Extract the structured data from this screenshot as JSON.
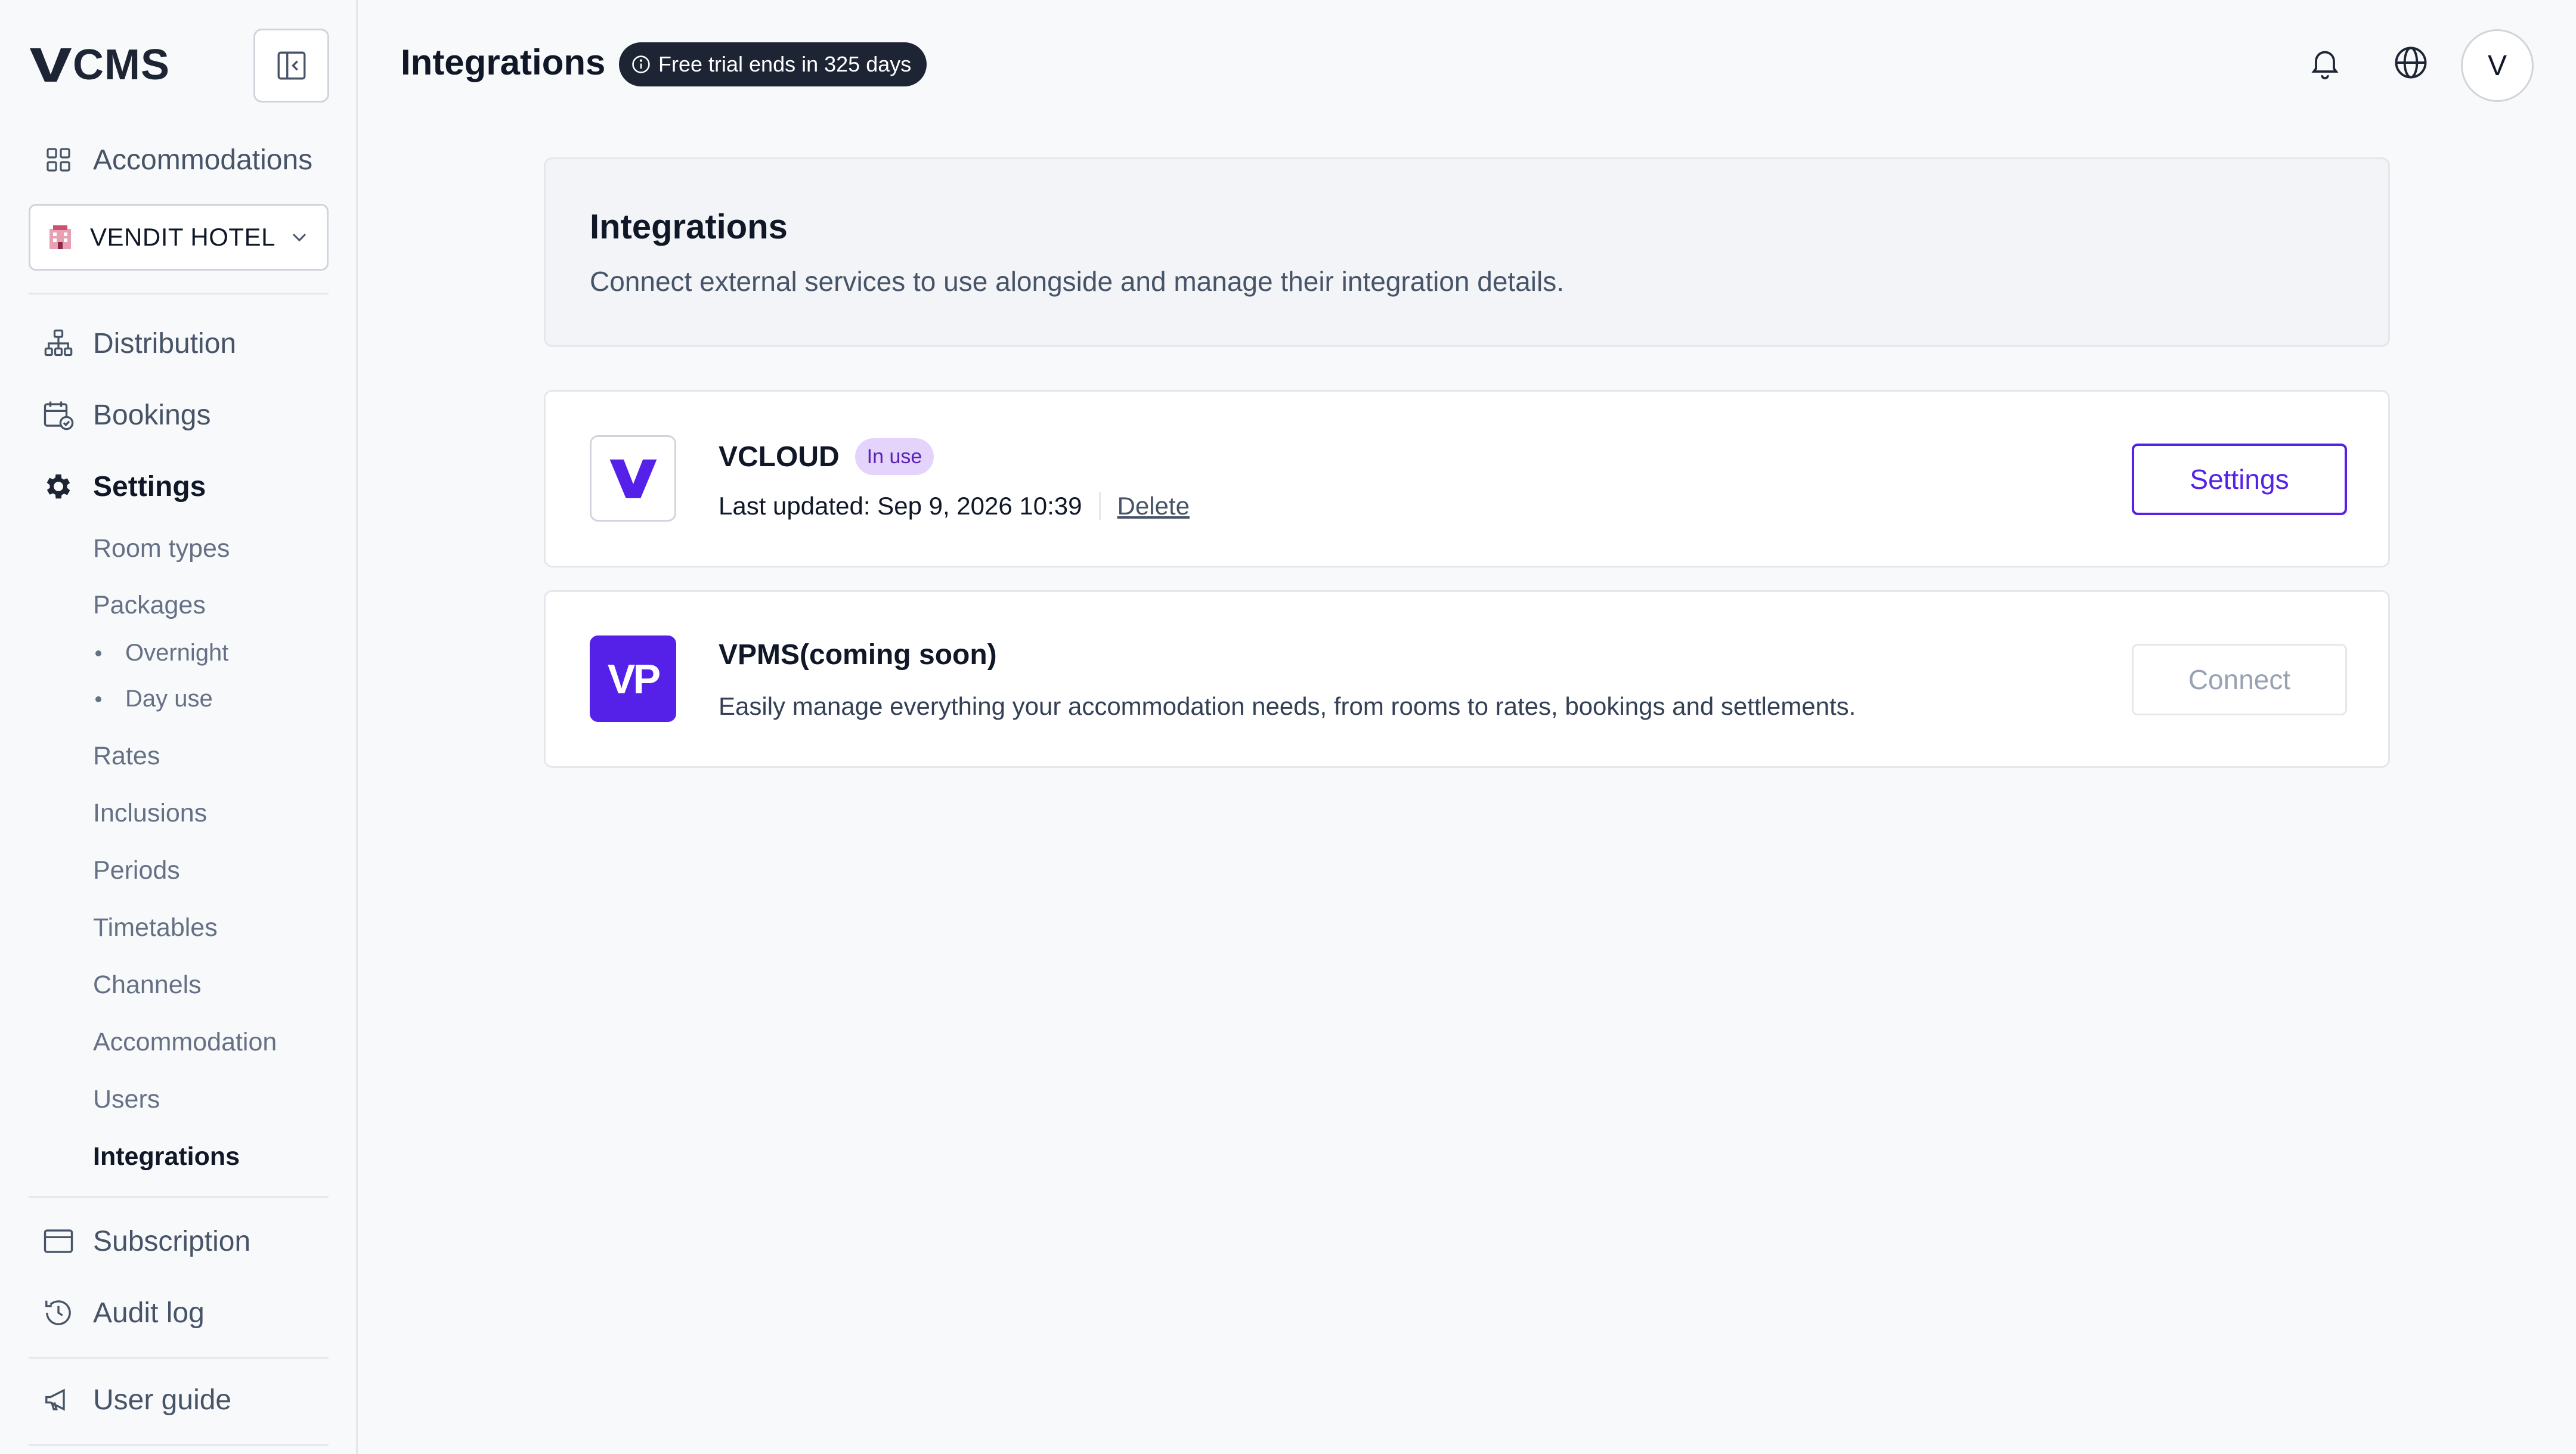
{
  "sidebar": {
    "brand": "CMS",
    "accommodations_label": "Accommodations",
    "hotel_name": "VENDIT HOTEL",
    "nav": {
      "distribution": "Distribution",
      "bookings": "Bookings",
      "settings": "Settings",
      "subscription": "Subscription",
      "audit_log": "Audit log",
      "user_guide": "User guide"
    },
    "settings_items": {
      "room_types": "Room types",
      "packages": "Packages",
      "overnight": "Overnight",
      "day_use": "Day use",
      "rates": "Rates",
      "inclusions": "Inclusions",
      "periods": "Periods",
      "timetables": "Timetables",
      "channels": "Channels",
      "accommodation": "Accommodation",
      "users": "Users",
      "integrations": "Integrations"
    }
  },
  "header": {
    "title": "Integrations",
    "trial_badge": "Free trial ends in 325 days",
    "avatar_initial": "V"
  },
  "intro": {
    "title": "Integrations",
    "subtitle": "Connect external services to use alongside and manage their integration details."
  },
  "integrations": [
    {
      "name": "VCLOUD",
      "status_badge": "In use",
      "last_updated": "Last updated: Sep 9, 2026 10:39",
      "delete_label": "Delete",
      "action_label": "Settings"
    },
    {
      "name": "VPMS(coming soon)",
      "logo_text": "VP",
      "description": "Easily manage everything your accommodation needs, from rooms to rates, bookings and settlements.",
      "action_label": "Connect"
    }
  ],
  "colors": {
    "accent": "#5521e8",
    "badge_dark": "#1d2433",
    "in_use_bg": "#e4d4fb"
  }
}
